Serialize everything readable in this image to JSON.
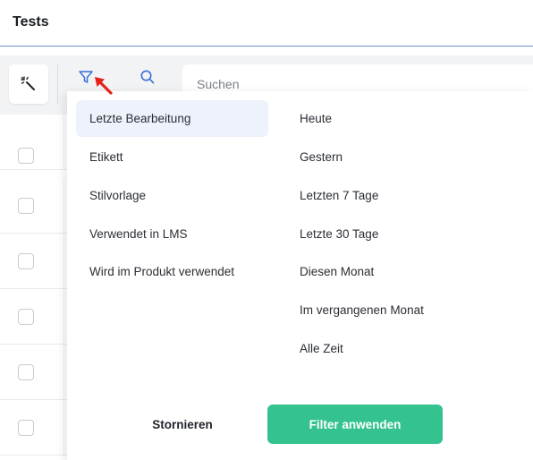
{
  "header": {
    "title": "Tests"
  },
  "toolbar": {
    "magic_icon": "magic-wand-icon",
    "filter_icon": "filter-icon",
    "search_icon": "search-icon",
    "search_placeholder": "Suchen"
  },
  "filter_menu": {
    "categories": [
      {
        "label": "Letzte Bearbeitung",
        "active": true
      },
      {
        "label": "Etikett",
        "active": false
      },
      {
        "label": "Stilvorlage",
        "active": false
      },
      {
        "label": "Verwendet in LMS",
        "active": false
      },
      {
        "label": "Wird im Produkt verwendet",
        "active": false
      }
    ],
    "options": [
      {
        "label": "Heute"
      },
      {
        "label": "Gestern"
      },
      {
        "label": "Letzten 7 Tage"
      },
      {
        "label": "Letzte 30 Tage"
      },
      {
        "label": "Diesen Monat"
      },
      {
        "label": "Im vergangenen Monat"
      },
      {
        "label": "Alle Zeit"
      }
    ],
    "cancel_label": "Stornieren",
    "apply_label": "Filter anwenden"
  },
  "colors": {
    "accent_blue": "#3b6fd8",
    "apply_green": "#34c38f",
    "pointer_red": "#e5231b"
  }
}
